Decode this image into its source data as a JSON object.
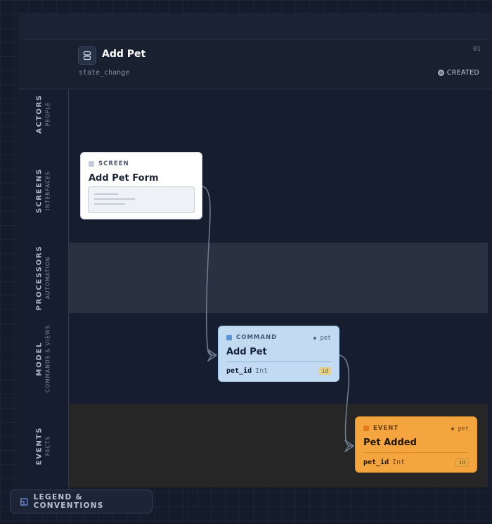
{
  "slice": {
    "title": "Add Pet",
    "type": "state_change",
    "number": "01",
    "status": "CREATED"
  },
  "lanes": [
    {
      "label": "ACTORS",
      "sublabel": "PEOPLE"
    },
    {
      "label": "SCREENS",
      "sublabel": "INTERFACES"
    },
    {
      "label": "PROCESSORS",
      "sublabel": "AUTOMATION"
    },
    {
      "label": "MODEL",
      "sublabel": "COMMANDS & VIEWS"
    },
    {
      "label": "EVENTS",
      "sublabel": "FACTS"
    }
  ],
  "screen_card": {
    "kind": "SCREEN",
    "title": "Add Pet Form"
  },
  "command_card": {
    "kind": "COMMAND",
    "context": "◆ pet",
    "title": "Add Pet",
    "field": {
      "name": "pet_id",
      "type": "Int",
      "badge": "id"
    }
  },
  "event_card": {
    "kind": "EVENT",
    "context": "◆ pet",
    "title": "Pet Added",
    "field": {
      "name": "pet_id",
      "type": "Int",
      "badge": "id"
    }
  },
  "legend": {
    "label": "LEGEND & CONVENTIONS"
  },
  "colors": {
    "screen": "#ffffff",
    "command": "#c3dbf2",
    "event": "#f5a53f",
    "processors_band": "#2a3141",
    "events_band": "#262626",
    "flow_line": "#6e7a90"
  },
  "icons": {
    "slice": "slice-glyph-icon",
    "status": "status-dot-icon",
    "legend": "legend-book-icon"
  }
}
